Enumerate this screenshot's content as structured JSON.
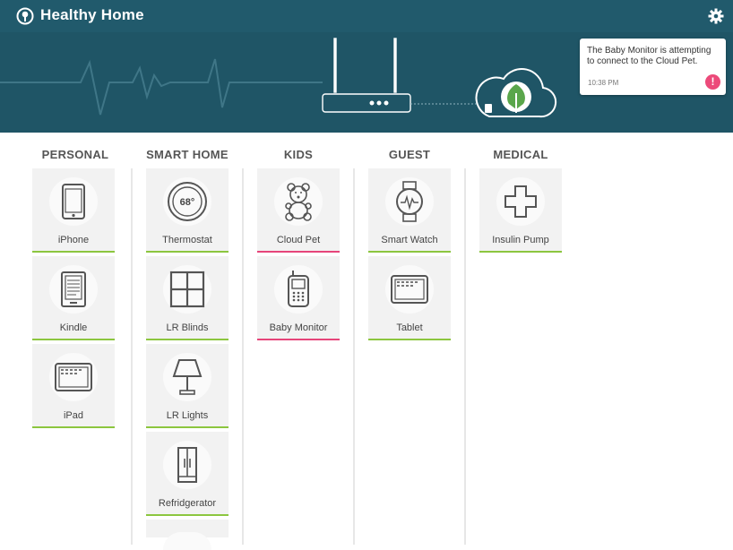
{
  "app": {
    "title": "Healthy Home"
  },
  "notification": {
    "message": "The Baby Monitor is attempting to connect to the Cloud Pet.",
    "time": "10:38 PM",
    "badge": "!"
  },
  "colors": {
    "topbar": "#215a6c",
    "banner": "#1f5566",
    "green": "#8cc63f",
    "pink": "#e6457a",
    "alert": "#ec4a7a"
  },
  "columns": [
    {
      "heading": "PERSONAL",
      "tiles": [
        {
          "label": "iPhone",
          "icon": "phone-icon"
        },
        {
          "label": "Kindle",
          "icon": "ereader-icon"
        },
        {
          "label": "iPad",
          "icon": "tablet-icon"
        }
      ]
    },
    {
      "heading": "SMART HOME",
      "tiles": [
        {
          "label": "Thermostat",
          "icon": "thermostat-icon",
          "reading": "68°"
        },
        {
          "label": "LR Blinds",
          "icon": "window-icon"
        },
        {
          "label": "LR Lights",
          "icon": "lamp-icon"
        },
        {
          "label": "Refridgerator",
          "icon": "fridge-icon"
        }
      ]
    },
    {
      "heading": "KIDS",
      "tiles": [
        {
          "label": "Cloud Pet",
          "icon": "teddy-bear-icon"
        },
        {
          "label": "Baby Monitor",
          "icon": "baby-monitor-icon"
        }
      ]
    },
    {
      "heading": "GUEST",
      "tiles": [
        {
          "label": "Smart Watch",
          "icon": "watch-icon"
        },
        {
          "label": "Tablet",
          "icon": "tablet-icon"
        }
      ]
    },
    {
      "heading": "MEDICAL",
      "tiles": [
        {
          "label": "Insulin Pump",
          "icon": "medical-cross-icon"
        }
      ]
    }
  ]
}
